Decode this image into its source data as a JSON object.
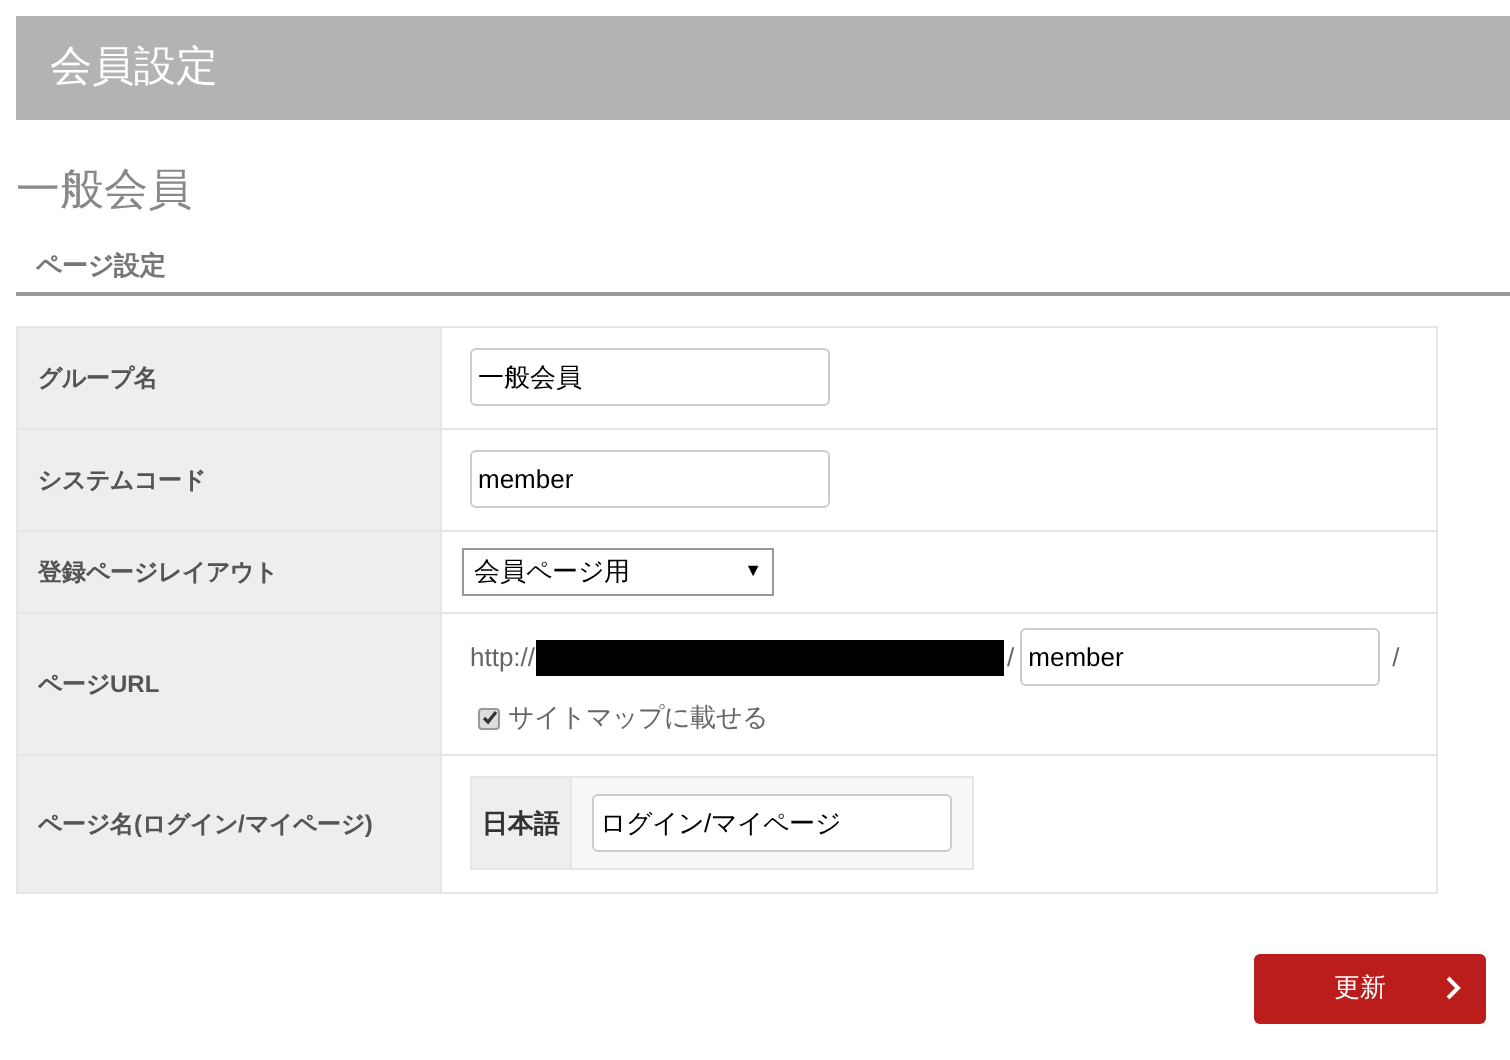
{
  "header": {
    "title": "会員設定"
  },
  "page_title": "一般会員",
  "section": {
    "title": "ページ設定"
  },
  "rows": [
    {
      "kind": "text",
      "label": "グループ名",
      "value": "一般会員"
    },
    {
      "kind": "text",
      "label": "システムコード",
      "value": "member"
    },
    {
      "kind": "select",
      "label": "登録ページレイアウト",
      "value": "会員ページ用",
      "caret": "▼"
    },
    {
      "kind": "url",
      "label": "ページURL",
      "prefix": "http://",
      "separator": "/",
      "value": "member",
      "suffix": "/",
      "sitemap": {
        "label": "サイトマップに載せる",
        "checked": true
      }
    },
    {
      "kind": "lang",
      "label": "ページ名(ログイン/マイページ)",
      "lang": "日本語",
      "value": "ログイン/マイページ"
    }
  ],
  "button": {
    "label": "更新"
  }
}
